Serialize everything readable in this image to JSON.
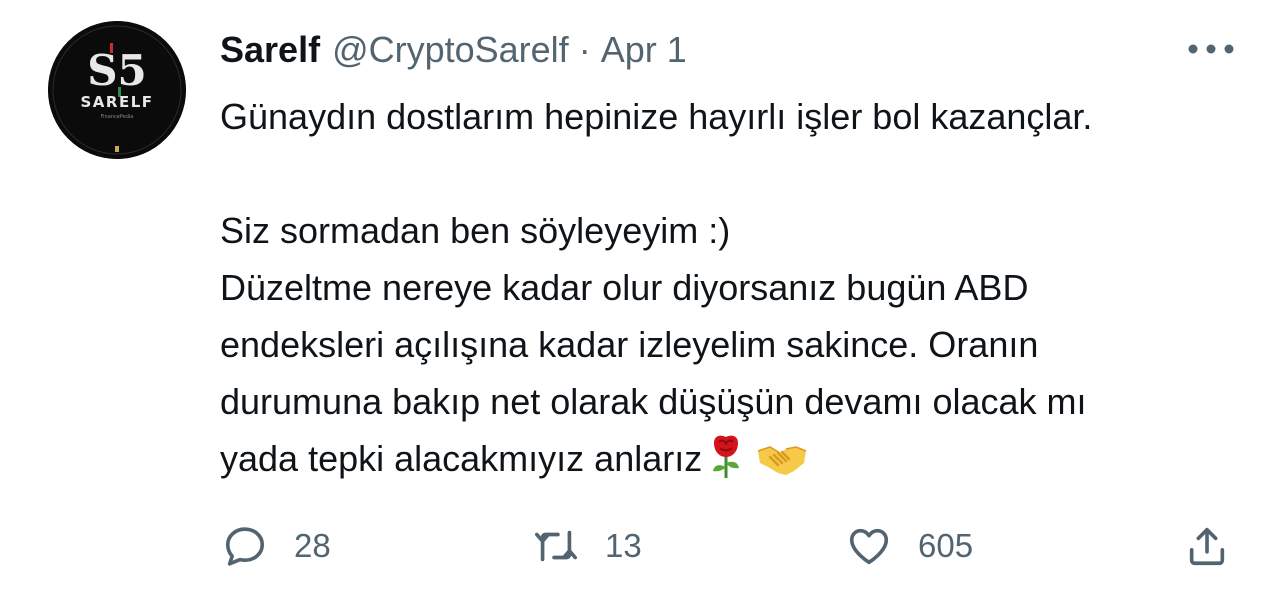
{
  "author": {
    "display_name": "Sarelf",
    "handle": "@CryptoSarelf",
    "date": "Apr 1",
    "separator": "·",
    "avatar": {
      "monogram": "S5",
      "wordmark": "SARELF",
      "tagline": "FinancePedia"
    }
  },
  "tweet": {
    "lines": [
      "Günaydın dostlarım hepinize hayırlı işler bol kazançlar.",
      "",
      "Siz sormadan ben söyleyeyim :)",
      "Düzeltme nereye kadar olur diyorsanız bugün ABD",
      "endeksleri açılışına kadar izleyelim sakince. Oranın",
      "durumuna bakıp net olarak düşüşün devamı olacak mı",
      "yada tepki alacakmıyız anlarız"
    ],
    "emojis": [
      "rose-emoji",
      "handshake-emoji"
    ]
  },
  "actions": {
    "reply": {
      "icon": "reply-icon",
      "count": "28"
    },
    "retweet": {
      "icon": "retweet-icon",
      "count": "13"
    },
    "like": {
      "icon": "heart-icon",
      "count": "605"
    },
    "share": {
      "icon": "share-icon"
    }
  },
  "colors": {
    "text_primary": "#0f1419",
    "text_secondary": "#536471",
    "background": "#ffffff",
    "avatar_bg": "#0b0b0b"
  }
}
